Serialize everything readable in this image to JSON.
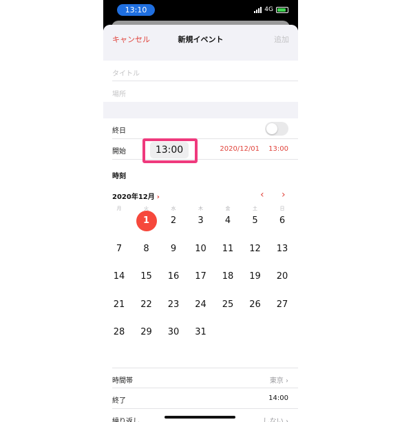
{
  "status_bar": {
    "time": "13:10",
    "network": "4G"
  },
  "nav": {
    "cancel": "キャンセル",
    "title": "新規イベント",
    "add": "追加"
  },
  "fields": {
    "title_placeholder": "タイトル",
    "location_placeholder": "場所"
  },
  "all_day": {
    "label": "終日",
    "value": false
  },
  "start": {
    "label": "開始",
    "date": "2020/12/01",
    "time": "13:00"
  },
  "time_row": {
    "label": "時刻",
    "value": "13:00"
  },
  "calendar": {
    "month": "2020年12月",
    "month_chevron": "›",
    "prev_icon": "‹",
    "next_icon": "›",
    "weekdays": [
      "月",
      "火",
      "水",
      "木",
      "金",
      "土",
      "日"
    ],
    "days": [
      "1",
      "2",
      "3",
      "4",
      "5",
      "6",
      "7",
      "8",
      "9",
      "10",
      "11",
      "12",
      "13",
      "14",
      "15",
      "16",
      "17",
      "18",
      "19",
      "20",
      "21",
      "22",
      "23",
      "24",
      "25",
      "26",
      "27",
      "28",
      "29",
      "30",
      "31"
    ],
    "first_weekday_index": 1,
    "selected_day": "1"
  },
  "timezone": {
    "label": "時間帯",
    "value": "東京 ›"
  },
  "end": {
    "label": "終了",
    "time": "14:00"
  },
  "repeat": {
    "label": "繰り返し",
    "value": "しない ›"
  },
  "colors": {
    "accent": "#e0423a",
    "highlight": "#ef3a7d",
    "selected": "#f6483c"
  }
}
